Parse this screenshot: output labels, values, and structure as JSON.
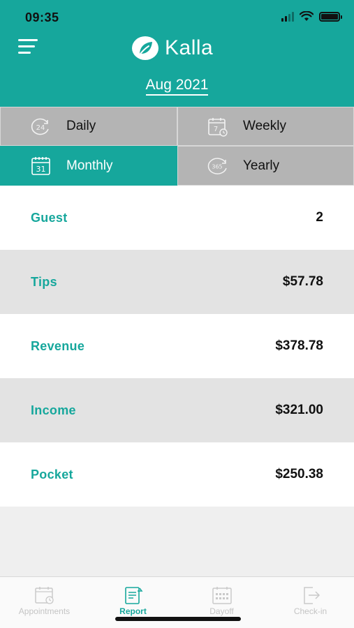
{
  "status_bar": {
    "time": "09:35"
  },
  "header": {
    "app_name": "Kalla",
    "period_label": "Aug 2021"
  },
  "periods": [
    {
      "label": "Daily",
      "icon": "24-hour-icon",
      "icon_text": "24",
      "active": false
    },
    {
      "label": "Weekly",
      "icon": "calendar-7-icon",
      "icon_text": "7",
      "active": false
    },
    {
      "label": "Monthly",
      "icon": "calendar-31-icon",
      "icon_text": "31",
      "active": true
    },
    {
      "label": "Yearly",
      "icon": "365-icon",
      "icon_text": "365",
      "active": false
    }
  ],
  "stats": [
    {
      "label": "Guest",
      "value": "2"
    },
    {
      "label": "Tips",
      "value": "$57.78"
    },
    {
      "label": "Revenue",
      "value": "$378.78"
    },
    {
      "label": "Income",
      "value": "$321.00"
    },
    {
      "label": "Pocket",
      "value": "$250.38"
    }
  ],
  "tabbar": {
    "items": [
      {
        "label": "Appointments",
        "icon": "calendar-clock-icon",
        "active": false
      },
      {
        "label": "Report",
        "icon": "report-icon",
        "active": true
      },
      {
        "label": "Dayoff",
        "icon": "calendar-grid-icon",
        "active": false
      },
      {
        "label": "Check-in",
        "icon": "checkin-icon",
        "active": false
      }
    ]
  },
  "colors": {
    "accent": "#16a79c",
    "inactive_tab": "#b4b4b4",
    "row_gray": "#e3e3e3"
  }
}
